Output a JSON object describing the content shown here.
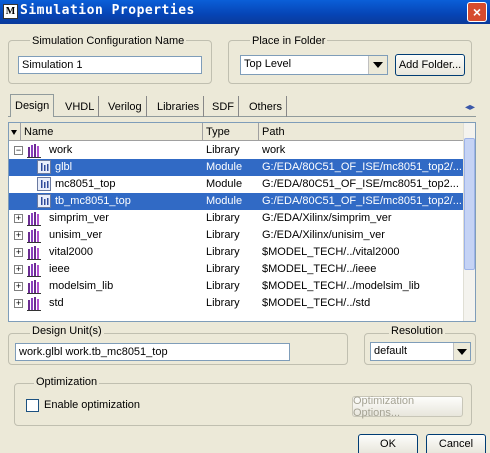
{
  "window": {
    "title": "Simulation Properties",
    "icon_glyph": "M",
    "close_glyph": "×"
  },
  "config_name": {
    "label": "Simulation Configuration Name",
    "value": "Simulation 1"
  },
  "folder": {
    "label": "Place in Folder",
    "value": "Top Level",
    "add_button": "Add Folder..."
  },
  "tabs": [
    {
      "label": "Design",
      "active": true
    },
    {
      "label": "VHDL"
    },
    {
      "label": "Verilog"
    },
    {
      "label": "Libraries"
    },
    {
      "label": "SDF"
    },
    {
      "label": "Others"
    }
  ],
  "tab_scroll": "◂▸",
  "list": {
    "columns": [
      "Name",
      "Type",
      "Path"
    ],
    "rows": [
      {
        "expander": "−",
        "icon": "library-icon",
        "name": "work",
        "type": "Library",
        "path": "work",
        "selected": false
      },
      {
        "expander": "",
        "icon": "module-icon",
        "name": "glbl",
        "type": "Module",
        "path": "G:/EDA/80C51_OF_ISE/mc8051_top2/...",
        "selected": true
      },
      {
        "expander": "",
        "icon": "module-icon",
        "name": "mc8051_top",
        "type": "Module",
        "path": "G:/EDA/80C51_OF_ISE/mc8051_top2...",
        "selected": false
      },
      {
        "expander": "",
        "icon": "module-icon",
        "name": "tb_mc8051_top",
        "type": "Module",
        "path": "G:/EDA/80C51_OF_ISE/mc8051_top2/...",
        "selected": true
      },
      {
        "expander": "+",
        "icon": "library-icon",
        "name": "simprim_ver",
        "type": "Library",
        "path": "G:/EDA/Xilinx/simprim_ver",
        "selected": false
      },
      {
        "expander": "+",
        "icon": "library-icon",
        "name": "unisim_ver",
        "type": "Library",
        "path": "G:/EDA/Xilinx/unisim_ver",
        "selected": false
      },
      {
        "expander": "+",
        "icon": "library-icon",
        "name": "vital2000",
        "type": "Library",
        "path": "$MODEL_TECH/../vital2000",
        "selected": false
      },
      {
        "expander": "+",
        "icon": "library-icon",
        "name": "ieee",
        "type": "Library",
        "path": "$MODEL_TECH/../ieee",
        "selected": false
      },
      {
        "expander": "+",
        "icon": "library-icon",
        "name": "modelsim_lib",
        "type": "Library",
        "path": "$MODEL_TECH/../modelsim_lib",
        "selected": false
      },
      {
        "expander": "+",
        "icon": "library-icon",
        "name": "std",
        "type": "Library",
        "path": "$MODEL_TECH/../std",
        "selected": false
      }
    ]
  },
  "design_units": {
    "label": "Design Unit(s)",
    "value": "work.glbl work.tb_mc8051_top"
  },
  "resolution": {
    "label": "Resolution",
    "value": "default"
  },
  "optimization": {
    "label": "Optimization",
    "checkbox_label": "Enable optimization",
    "checked": false,
    "options_button": "Optimization Options..."
  },
  "footer": {
    "ok": "OK",
    "cancel": "Cancel"
  },
  "colors": {
    "selection": "#316ac5",
    "titlebar": "#0a5fd8",
    "dialog_bg": "#ece9d8",
    "library_icon": "#6a2c91"
  }
}
